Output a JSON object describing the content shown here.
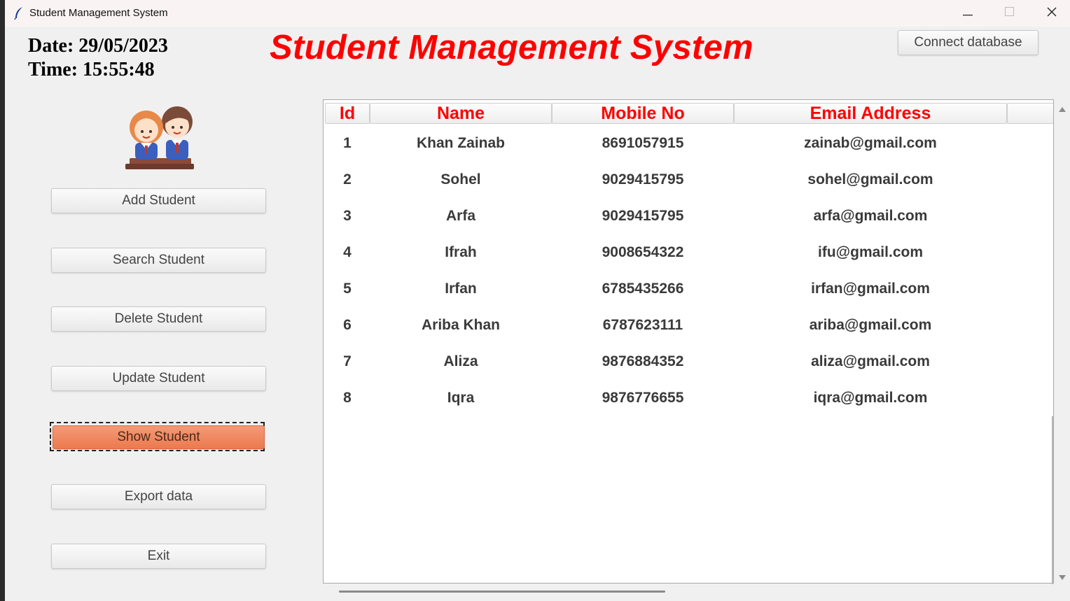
{
  "window": {
    "title": "Student Management System",
    "accent_color": "#ff0000",
    "active_button_color": "#ef8a5f"
  },
  "header": {
    "date_text": "Date: 29/05/2023",
    "time_text": "Time: 15:55:48",
    "title": "Student Management System",
    "connect_label": "Connect database"
  },
  "sidebar": {
    "avatar_icon": "students-avatar-icon",
    "buttons": [
      {
        "label": "Add Student"
      },
      {
        "label": "Search Student"
      },
      {
        "label": "Delete Student"
      },
      {
        "label": "Update Student"
      },
      {
        "label": "Show Student",
        "active": true
      },
      {
        "label": "Export data"
      },
      {
        "label": "Exit"
      }
    ]
  },
  "table": {
    "columns": [
      "Id",
      "Name",
      "Mobile No",
      "Email Address"
    ],
    "rows": [
      {
        "id": "1",
        "name": "Khan Zainab",
        "mobile": "8691057915",
        "email": "zainab@gmail.com"
      },
      {
        "id": "2",
        "name": "Sohel",
        "mobile": "9029415795",
        "email": "sohel@gmail.com"
      },
      {
        "id": "3",
        "name": "Arfa",
        "mobile": "9029415795",
        "email": "arfa@gmail.com"
      },
      {
        "id": "4",
        "name": "Ifrah",
        "mobile": "9008654322",
        "email": "ifu@gmail.com"
      },
      {
        "id": "5",
        "name": "Irfan",
        "mobile": "6785435266",
        "email": "irfan@gmail.com"
      },
      {
        "id": "6",
        "name": "Ariba Khan",
        "mobile": "6787623111",
        "email": "ariba@gmail.com"
      },
      {
        "id": "7",
        "name": "Aliza",
        "mobile": "9876884352",
        "email": "aliza@gmail.com"
      },
      {
        "id": "8",
        "name": "Iqra",
        "mobile": "9876776655",
        "email": "iqra@gmail.com"
      }
    ]
  }
}
